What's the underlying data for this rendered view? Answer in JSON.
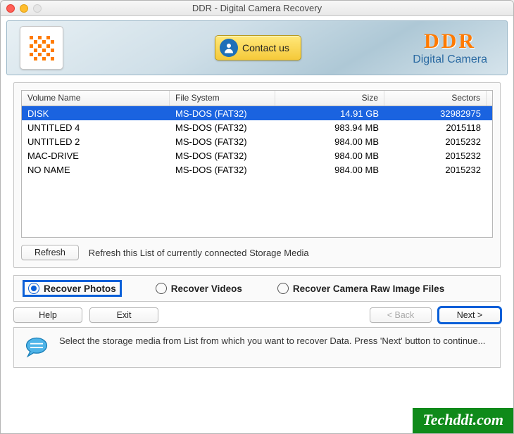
{
  "window": {
    "title": "DDR - Digital Camera Recovery"
  },
  "banner": {
    "contact_label": "Contact us",
    "brand": "DDR",
    "brand_sub": "Digital Camera"
  },
  "table": {
    "headers": {
      "name": "Volume Name",
      "fs": "File System",
      "size": "Size",
      "sectors": "Sectors"
    },
    "rows": [
      {
        "name": "DISK",
        "fs": "MS-DOS (FAT32)",
        "size": "14.91  GB",
        "sectors": "32982975",
        "selected": true
      },
      {
        "name": "UNTITLED 4",
        "fs": "MS-DOS (FAT32)",
        "size": "983.94  MB",
        "sectors": "2015118",
        "selected": false
      },
      {
        "name": "UNTITLED 2",
        "fs": "MS-DOS (FAT32)",
        "size": "984.00  MB",
        "sectors": "2015232",
        "selected": false
      },
      {
        "name": "MAC-DRIVE",
        "fs": "MS-DOS (FAT32)",
        "size": "984.00  MB",
        "sectors": "2015232",
        "selected": false
      },
      {
        "name": "NO NAME",
        "fs": "MS-DOS (FAT32)",
        "size": "984.00  MB",
        "sectors": "2015232",
        "selected": false
      }
    ]
  },
  "refresh": {
    "button": "Refresh",
    "text": "Refresh this List of currently connected Storage Media"
  },
  "options": {
    "photos": "Recover Photos",
    "videos": "Recover Videos",
    "raw": "Recover Camera Raw Image Files",
    "selected": "photos"
  },
  "nav": {
    "help": "Help",
    "exit": "Exit",
    "back": "< Back",
    "next": "Next >"
  },
  "info": {
    "text": "Select the storage media from List from which you want to recover Data. Press 'Next' button to continue..."
  },
  "watermark": "Techddi.com"
}
